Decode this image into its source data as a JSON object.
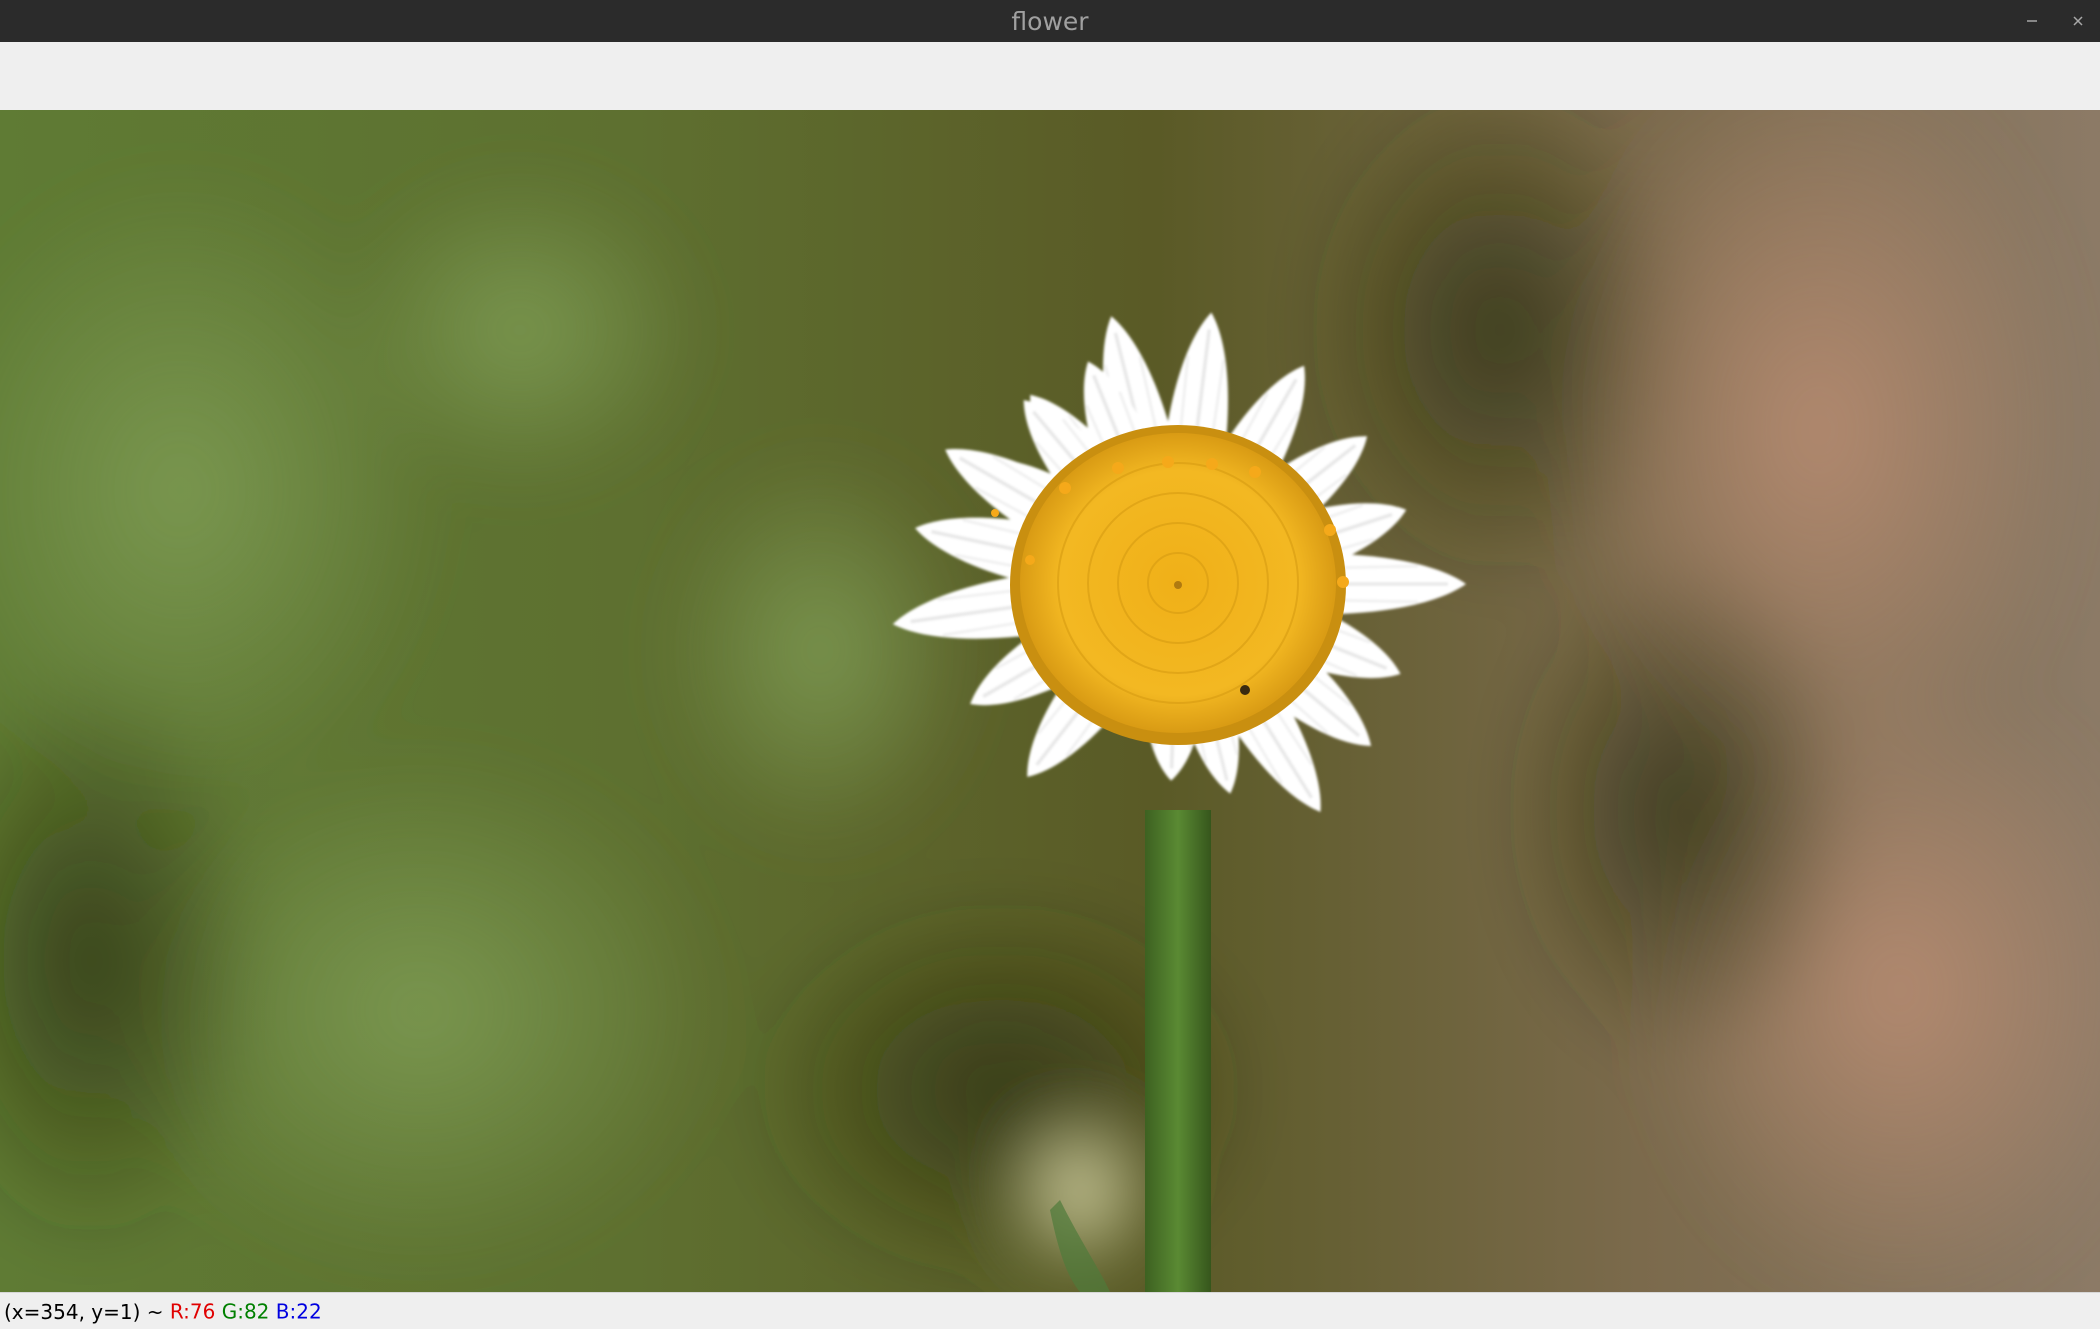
{
  "window": {
    "title": "flower",
    "controls": [
      {
        "name": "minimize",
        "icon": "minimize-icon"
      },
      {
        "name": "close",
        "icon": "close-icon"
      }
    ]
  },
  "image": {
    "subject_colors": {
      "petal": "#ffffff",
      "center": "#f2b21b",
      "stem": "#4f7a2a",
      "background_left": "#6c8a3c",
      "background_right": "#9c7a5a"
    }
  },
  "status": {
    "coords": "(x=354, y=1) ~",
    "r": "R:76",
    "g": "G:82",
    "b": "B:22",
    "colors": {
      "r": "#e00000",
      "g": "#008000",
      "b": "#0000e0"
    }
  }
}
